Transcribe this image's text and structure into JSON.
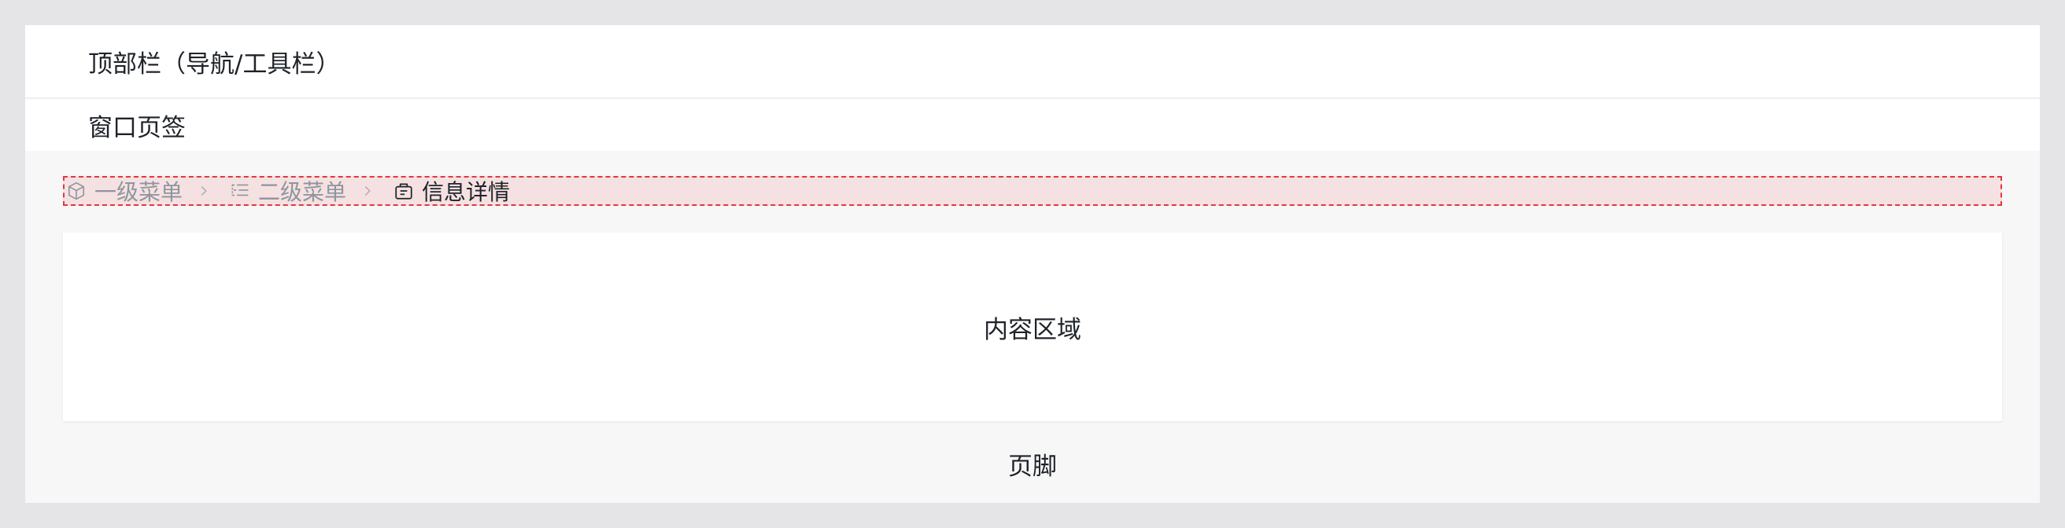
{
  "topbar": {
    "title": "顶部栏（导航/工具栏）"
  },
  "tabs": {
    "label": "窗口页签"
  },
  "breadcrumb": {
    "items": [
      {
        "label": "一级菜单",
        "icon": "cube-icon"
      },
      {
        "label": "二级菜单",
        "icon": "list-icon"
      },
      {
        "label": "信息详情",
        "icon": "briefcase-icon"
      }
    ]
  },
  "content": {
    "label": "内容区域"
  },
  "footer": {
    "label": "页脚"
  },
  "colors": {
    "background": "#e5e5e7",
    "panel": "#f7f7f7",
    "breadcrumb_highlight": "#f5e1e2",
    "breadcrumb_border": "#e0383e",
    "muted_text": "#8f959e",
    "text": "#1f2329"
  }
}
